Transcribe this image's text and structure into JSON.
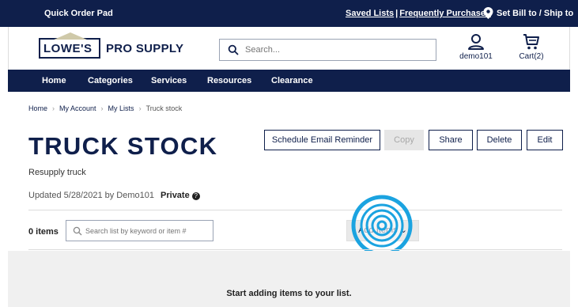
{
  "topbar": {
    "quick_order": "Quick Order Pad",
    "saved_lists": "Saved Lists",
    "separator": "|",
    "frequently_purchased": "Frequently Purchased",
    "bill_ship": "Set Bill to / Ship to"
  },
  "header": {
    "logo_text": "LOWE'S",
    "logo_sub": "PRO SUPPLY",
    "search_placeholder": "Search...",
    "account_label": "demo101",
    "cart_label": "Cart(2)"
  },
  "nav": {
    "items": [
      "Home",
      "Categories",
      "Services",
      "Resources",
      "Clearance"
    ]
  },
  "breadcrumb": {
    "items": [
      "Home",
      "My Account",
      "My Lists",
      "Truck stock"
    ]
  },
  "list": {
    "title": "TRUCK STOCK",
    "description": "Resupply truck",
    "updated": "Updated 5/28/2021 by Demo101",
    "privacy": "Private",
    "item_count": "0 items",
    "search_placeholder": "Search list by keyword or item #",
    "add_items": "Add Items",
    "empty_message": "Start adding items to your list."
  },
  "actions": {
    "schedule": "Schedule Email Reminder",
    "copy": "Copy",
    "share": "Share",
    "delete": "Delete",
    "edit": "Edit"
  },
  "colors": {
    "brand_navy": "#0f1f4b",
    "click_ripple": "#1ba3e0"
  }
}
